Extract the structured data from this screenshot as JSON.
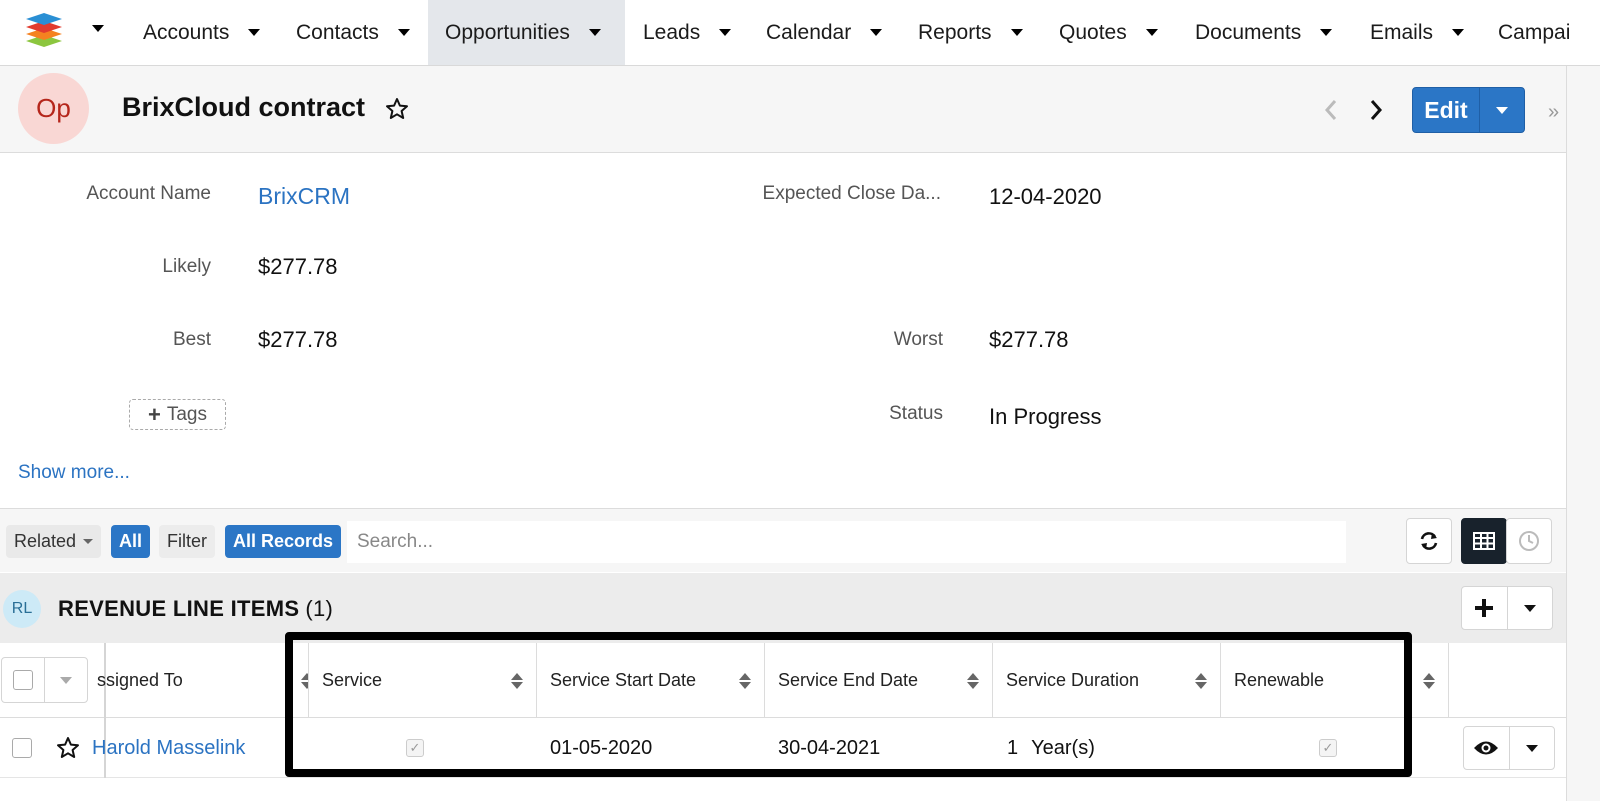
{
  "nav": {
    "items": [
      "Accounts",
      "Contacts",
      "Opportunities",
      "Leads",
      "Calendar",
      "Reports",
      "Quotes",
      "Documents",
      "Emails",
      "Campai"
    ],
    "active": "Opportunities"
  },
  "header": {
    "avatar": "Op",
    "title": "BrixCloud contract",
    "edit_label": "Edit",
    "side_toggle": "»"
  },
  "fields": {
    "account_name": {
      "label": "Account Name",
      "value": "BrixCRM"
    },
    "expected_close": {
      "label": "Expected Close Da...",
      "value": "12-04-2020"
    },
    "likely": {
      "label": "Likely",
      "value": "$277.78"
    },
    "best": {
      "label": "Best",
      "value": "$277.78"
    },
    "worst": {
      "label": "Worst",
      "value": "$277.78"
    },
    "status": {
      "label": "Status",
      "value": "In Progress"
    },
    "tags_label": "Tags",
    "show_more": "Show more..."
  },
  "related_bar": {
    "related_label": "Related",
    "all_label": "All",
    "filter_label": "Filter",
    "all_records_label": "All Records",
    "search_placeholder": "Search..."
  },
  "subpanel": {
    "avatar": "RL",
    "title": "REVENUE LINE ITEMS",
    "count": "(1)"
  },
  "table": {
    "columns": [
      "ssigned To",
      "Service",
      "Service Start Date",
      "Service End Date",
      "Service Duration",
      "Renewable"
    ],
    "rows": [
      {
        "assigned_to": "Harold Masselink",
        "service_checked": true,
        "service_start": "01-05-2020",
        "service_end": "30-04-2021",
        "duration_num": "1",
        "duration_unit": "Year(s)",
        "renewable_checked": true
      }
    ]
  },
  "colors": {
    "accent": "#2b76c6",
    "link": "#2b73c2",
    "avatar_op_bg": "#f9d7d4",
    "avatar_rl_bg": "#cdeaf7"
  }
}
